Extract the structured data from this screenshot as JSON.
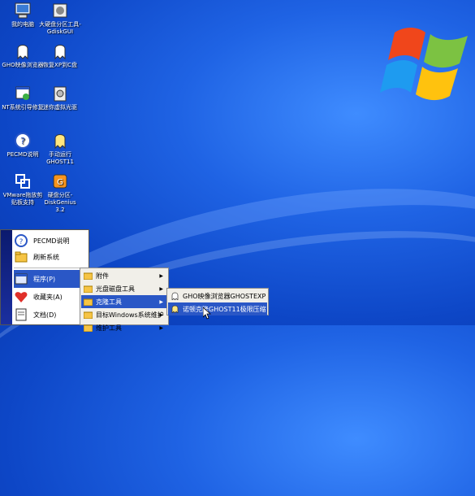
{
  "desktop_icons": [
    {
      "name": "computer",
      "label": "我的电脑"
    },
    {
      "name": "diskgenius-tool",
      "label": "大硬盘分区工具-GdiskGUI"
    },
    {
      "name": "gho-viewer",
      "label": "GHO映像浏览器"
    },
    {
      "name": "restore-xp",
      "label": "恢复XP到C盘"
    },
    {
      "name": "nt-boot-repair",
      "label": "NT系统引导修复"
    },
    {
      "name": "mini-virtual-cd",
      "label": "迷你虚拟光驱"
    },
    {
      "name": "pecmd-help",
      "label": "PECMD说明"
    },
    {
      "name": "ghost11-manual",
      "label": "手动运行GHOST11"
    },
    {
      "name": "vmware-drag",
      "label": "VMware拖放剪贴板支持"
    },
    {
      "name": "diskgenius",
      "label": "硬盘分区-DiskGenius 3.2"
    }
  ],
  "start_menu": {
    "pecmd": "PECMD说明",
    "refresh": "刷新系统",
    "programs": "程序(P)",
    "favorites": "收藏夹(A)",
    "documents": "文档(D)"
  },
  "programs_menu": [
    "附件",
    "光盘磁盘工具",
    "克隆工具",
    "目标Windows系统维护",
    "维护工具"
  ],
  "clone_menu": [
    "GHO映像浏览器GHOSTEXP",
    "诺顿克隆GHOST11极限压缩"
  ],
  "colors": {
    "highlight": "#2a57c6",
    "menu_bg": "#f1efe9"
  }
}
